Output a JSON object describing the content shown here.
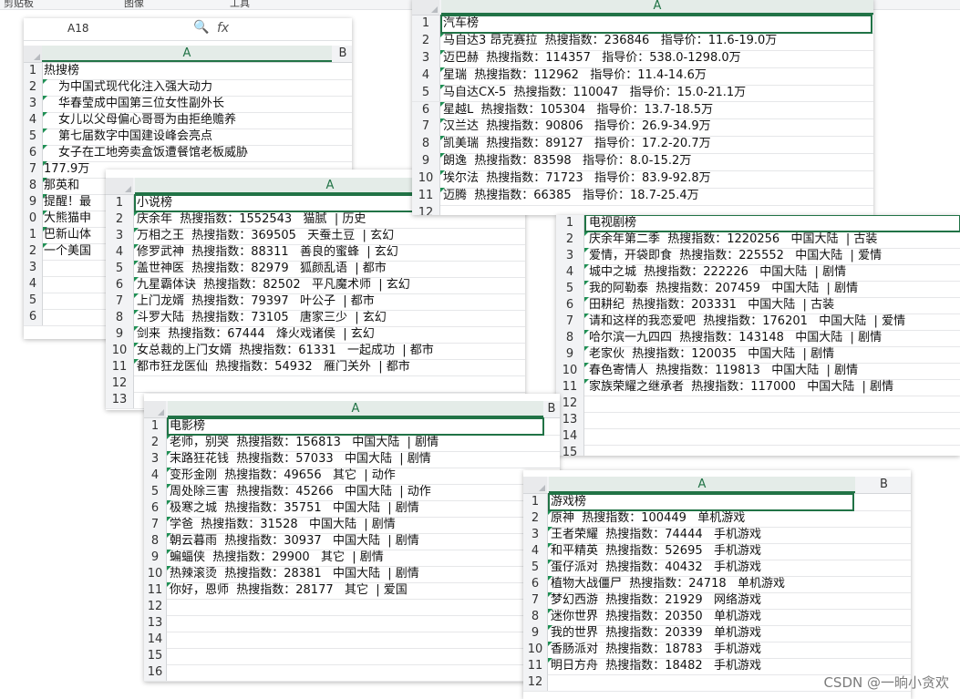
{
  "ribbon": {
    "items": [
      "剪贴板",
      "图像",
      "工具"
    ]
  },
  "namebox": "A18",
  "formula_icon": "fx",
  "sheets": {
    "rank": {
      "col_a": "A",
      "col_b": "B",
      "rows": [
        "热搜榜",
        "为中国式现代化注入强大动力",
        "华春莹成中国第三位女性副外长",
        "女儿以父母偏心哥哥为由拒绝赡养",
        "第七届数字中国建设峰会亮点",
        "女子在工地旁卖盒饭遭餐馆老板威胁",
        "177.9万",
        "那英和",
        "提醒！最",
        "大熊猫申",
        "巴新山体",
        "一个美国",
        "",
        "",
        "",
        ""
      ],
      "row_nums": [
        "1",
        "2",
        "3",
        "4",
        "5",
        "6",
        "7",
        "8",
        "9",
        "0",
        "1",
        "2",
        "3",
        "4",
        "5",
        "6"
      ]
    },
    "novel": {
      "col_a": "A",
      "rows": [
        "小说榜",
        "庆余年  热搜指数：1552543   猫腻  | 历史",
        "万相之王  热搜指数：369505   天蚕土豆  | 玄幻",
        "修罗武神  热搜指数：88311   善良的蜜蜂  | 玄幻",
        "盖世神医  热搜指数：82979   狐颜乱语  | 都市",
        "九星霸体诀  热搜指数：82502   平凡魔术师  | 玄幻",
        "上门龙婿  热搜指数：79397   叶公子  | 都市",
        "斗罗大陆  热搜指数：73105   唐家三少  | 玄幻",
        "剑来  热搜指数：67444   烽火戏诸侯  | 玄幻",
        "女总裁的上门女婿  热搜指数：61331   一起成功  | 都市",
        "都市狂龙医仙  热搜指数：54932   雁门关外  | 都市",
        "",
        ""
      ],
      "row_nums": [
        "1",
        "2",
        "3",
        "4",
        "5",
        "6",
        "7",
        "8",
        "9",
        "10",
        "11",
        "12",
        "13"
      ]
    },
    "car": {
      "col_a": "A",
      "rows": [
        "汽车榜",
        "马自达3 昂克赛拉  热搜指数：236846   指导价：11.6-19.0万",
        "迈巴赫  热搜指数：114357   指导价：538.0-1298.0万",
        "星瑞  热搜指数：112962   指导价：11.4-14.6万",
        "马自达CX-5  热搜指数：110047   指导价：15.0-21.1万",
        "星越L  热搜指数：105304   指导价：13.7-18.5万",
        "汉兰达  热搜指数：90806   指导价：26.9-34.9万",
        "凯美瑞  热搜指数：89127   指导价：17.2-20.7万",
        "朗逸  热搜指数：83598   指导价：8.0-15.2万",
        "埃尔法  热搜指数：71723   指导价：83.9-92.8万",
        "迈腾  热搜指数：66385   指导价：18.7-25.4万",
        ""
      ],
      "row_nums": [
        "1",
        "2",
        "3",
        "4",
        "5",
        "6",
        "7",
        "8",
        "9",
        "10",
        "11",
        "12"
      ]
    },
    "tv": {
      "rows": [
        "电视剧榜",
        "庆余年第二季  热搜指数：1220256   中国大陆  | 古装",
        "爱情，开袋即食  热搜指数：225552   中国大陆  | 爱情",
        "城中之城  热搜指数：222226   中国大陆  | 剧情",
        "我的阿勒泰  热搜指数：207459   中国大陆  | 剧情",
        "田耕纪  热搜指数：203331   中国大陆  | 古装",
        "请和这样的我恋爱吧  热搜指数：176201   中国大陆  | 爱情",
        "哈尔滨一九四四  热搜指数：143148   中国大陆  | 剧情",
        "老家伙  热搜指数：120035   中国大陆  | 剧情",
        "春色寄情人  热搜指数：119813   中国大陆  | 剧情",
        "家族荣耀之继承者  热搜指数：117000   中国大陆  | 剧情",
        "",
        "",
        "",
        ""
      ],
      "row_nums": [
        "1",
        "2",
        "3",
        "4",
        "5",
        "6",
        "7",
        "8",
        "9",
        "10",
        "11",
        "12",
        "13",
        "14",
        "15"
      ]
    },
    "movie": {
      "col_a": "A",
      "col_b": "B",
      "rows": [
        "电影榜",
        "老师，别哭  热搜指数：156813   中国大陆  | 剧情",
        "末路狂花钱  热搜指数：57033   中国大陆  | 剧情",
        "变形金刚  热搜指数：49656   其它  | 动作",
        "周处除三害  热搜指数：45266   中国大陆  | 动作",
        "极寒之城  热搜指数：35751   中国大陆  | 剧情",
        "学爸  热搜指数：31528   中国大陆  | 剧情",
        "朝云暮雨  热搜指数：30937   中国大陆  | 剧情",
        "蝙蝠侠  热搜指数：29900   其它  | 剧情",
        "热辣滚烫  热搜指数：28381   中国大陆  | 剧情",
        "你好，恩师  热搜指数：28177   其它  | 爱国",
        "",
        "",
        "",
        "",
        ""
      ],
      "row_nums": [
        "1",
        "2",
        "3",
        "4",
        "5",
        "6",
        "7",
        "8",
        "9",
        "10",
        "11",
        "12",
        "13",
        "14",
        "15",
        "16"
      ]
    },
    "game": {
      "col_a": "A",
      "col_b": "B",
      "rows": [
        "游戏榜",
        "原神  热搜指数：100449   单机游戏",
        "王者荣耀  热搜指数：74444   手机游戏",
        "和平精英  热搜指数：52695   手机游戏",
        "蛋仔派对  热搜指数：40432   手机游戏",
        "植物大战僵尸  热搜指数：24718   单机游戏",
        "梦幻西游  热搜指数：21929   网络游戏",
        "迷你世界  热搜指数：20350   单机游戏",
        "我的世界  热搜指数：20339   单机游戏",
        "香肠派对  热搜指数：18783   手机游戏",
        "明日方舟  热搜指数：18482   手机游戏",
        ""
      ],
      "row_nums": [
        "1",
        "2",
        "3",
        "4",
        "5",
        "6",
        "7",
        "8",
        "9",
        "10",
        "11",
        "12"
      ]
    }
  },
  "watermark": "CSDN @一晌小贪欢"
}
